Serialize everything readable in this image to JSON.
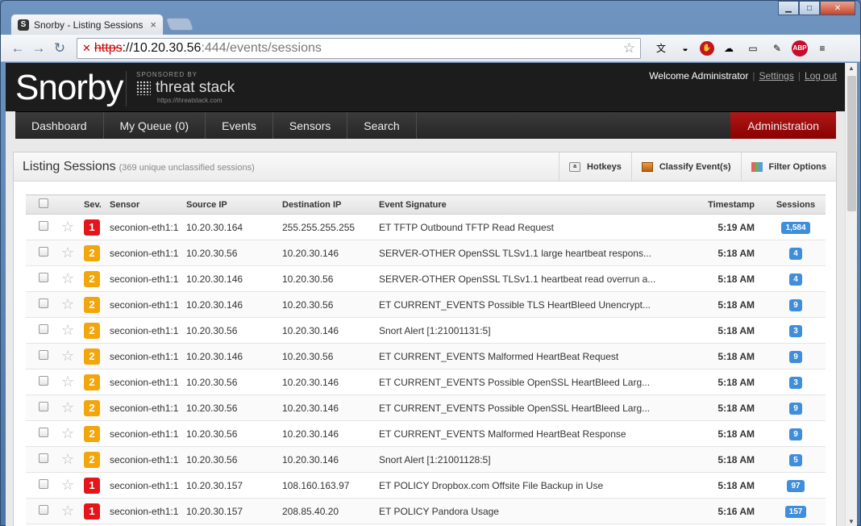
{
  "browser": {
    "tab_title": "Snorby - Listing Sessions",
    "tab_close": "×",
    "url_scheme": "https",
    "url_host": "://10.20.30.56",
    "url_path": ":444/events/sessions",
    "abp_label": "ABP"
  },
  "header": {
    "logo": "Snorby",
    "sponsored_by": "SPONSORED BY",
    "sponsor_brand": "threat stack",
    "sponsor_url": "https://threatstack.com",
    "welcome": "Welcome Administrator",
    "settings": "Settings",
    "logout": "Log out"
  },
  "nav": {
    "items": [
      "Dashboard",
      "My Queue (0)",
      "Events",
      "Sensors",
      "Search"
    ],
    "admin": "Administration"
  },
  "panel": {
    "title": "Listing Sessions",
    "subtitle": "(369 unique unclassified sessions)",
    "hotkeys": "Hotkeys",
    "classify": "Classify Event(s)",
    "filter": "Filter Options"
  },
  "columns": {
    "sev": "Sev.",
    "sensor": "Sensor",
    "src": "Source IP",
    "dst": "Destination IP",
    "sig": "Event Signature",
    "ts": "Timestamp",
    "sessions": "Sessions"
  },
  "colors": {
    "sev1": "#e4161b",
    "sev2": "#f2a60b",
    "badge": "#3f8edb",
    "admin": "#9b0b0b"
  },
  "rows": [
    {
      "sev": "1",
      "sensor": "seconion-eth1:1",
      "src": "10.20.30.164",
      "dst": "255.255.255.255",
      "sig": "ET TFTP Outbound TFTP Read Request",
      "ts": "5:19 AM",
      "sessions": "1,584"
    },
    {
      "sev": "2",
      "sensor": "seconion-eth1:1",
      "src": "10.20.30.56",
      "dst": "10.20.30.146",
      "sig": "SERVER-OTHER OpenSSL TLSv1.1 large heartbeat respons...",
      "ts": "5:18 AM",
      "sessions": "4"
    },
    {
      "sev": "2",
      "sensor": "seconion-eth1:1",
      "src": "10.20.30.146",
      "dst": "10.20.30.56",
      "sig": "SERVER-OTHER OpenSSL TLSv1.1 heartbeat read overrun a...",
      "ts": "5:18 AM",
      "sessions": "4"
    },
    {
      "sev": "2",
      "sensor": "seconion-eth1:1",
      "src": "10.20.30.146",
      "dst": "10.20.30.56",
      "sig": "ET CURRENT_EVENTS Possible TLS HeartBleed Unencrypt...",
      "ts": "5:18 AM",
      "sessions": "9"
    },
    {
      "sev": "2",
      "sensor": "seconion-eth1:1",
      "src": "10.20.30.56",
      "dst": "10.20.30.146",
      "sig": "Snort Alert [1:21001131:5]",
      "ts": "5:18 AM",
      "sessions": "3"
    },
    {
      "sev": "2",
      "sensor": "seconion-eth1:1",
      "src": "10.20.30.146",
      "dst": "10.20.30.56",
      "sig": "ET CURRENT_EVENTS Malformed HeartBeat Request",
      "ts": "5:18 AM",
      "sessions": "9"
    },
    {
      "sev": "2",
      "sensor": "seconion-eth1:1",
      "src": "10.20.30.56",
      "dst": "10.20.30.146",
      "sig": "ET CURRENT_EVENTS Possible OpenSSL HeartBleed Larg...",
      "ts": "5:18 AM",
      "sessions": "3"
    },
    {
      "sev": "2",
      "sensor": "seconion-eth1:1",
      "src": "10.20.30.56",
      "dst": "10.20.30.146",
      "sig": "ET CURRENT_EVENTS Possible OpenSSL HeartBleed Larg...",
      "ts": "5:18 AM",
      "sessions": "9"
    },
    {
      "sev": "2",
      "sensor": "seconion-eth1:1",
      "src": "10.20.30.56",
      "dst": "10.20.30.146",
      "sig": "ET CURRENT_EVENTS Malformed HeartBeat Response",
      "ts": "5:18 AM",
      "sessions": "9"
    },
    {
      "sev": "2",
      "sensor": "seconion-eth1:1",
      "src": "10.20.30.56",
      "dst": "10.20.30.146",
      "sig": "Snort Alert [1:21001128:5]",
      "ts": "5:18 AM",
      "sessions": "5"
    },
    {
      "sev": "1",
      "sensor": "seconion-eth1:1",
      "src": "10.20.30.157",
      "dst": "108.160.163.97",
      "sig": "ET POLICY Dropbox.com Offsite File Backup in Use",
      "ts": "5:18 AM",
      "sessions": "97"
    },
    {
      "sev": "1",
      "sensor": "seconion-eth1:1",
      "src": "10.20.30.157",
      "dst": "208.85.40.20",
      "sig": "ET POLICY Pandora Usage",
      "ts": "5:16 AM",
      "sessions": "157"
    }
  ]
}
